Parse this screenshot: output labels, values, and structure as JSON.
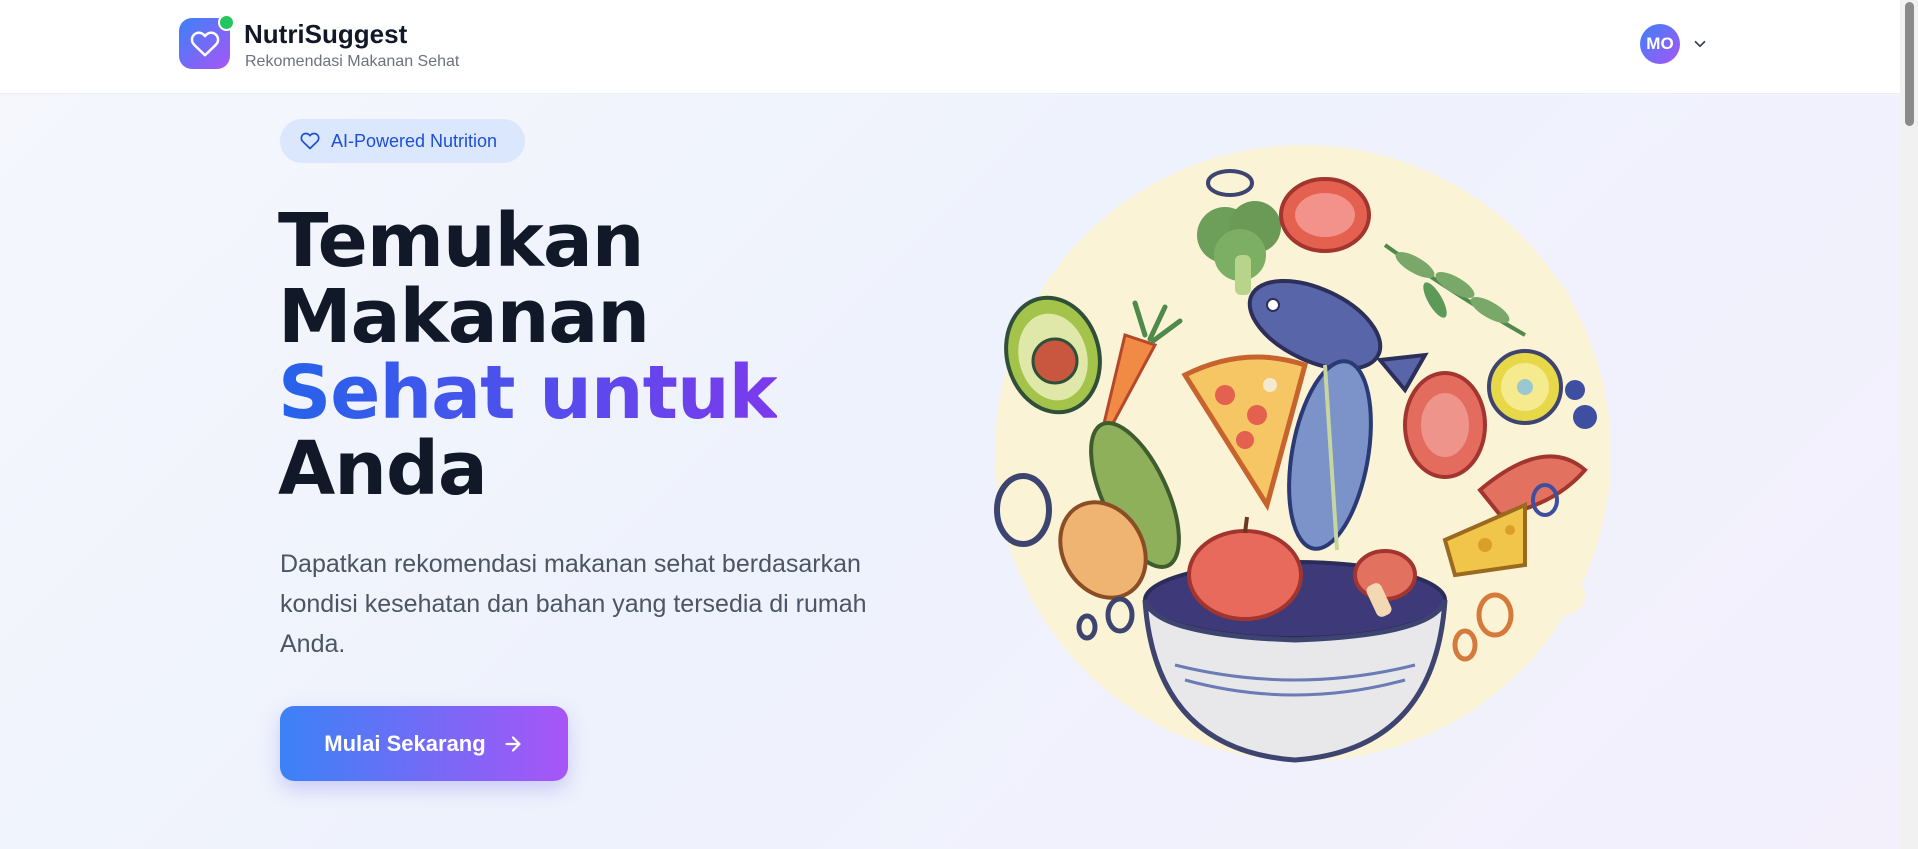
{
  "header": {
    "brand_name": "NutriSuggest",
    "brand_tagline": "Rekomendasi Makanan Sehat",
    "logo_icon": "heart-icon",
    "online_indicator_color": "#22c55e",
    "user_initials": "MO",
    "user_menu_icon": "chevron-down-icon"
  },
  "hero": {
    "badge_label": "AI-Powered Nutrition",
    "headline_line1": "Temukan",
    "headline_line2": "Makanan",
    "headline_highlight": "Sehat untuk",
    "headline_line4": "Anda",
    "description": "Dapatkan rekomendasi makanan sehat berdasarkan kondisi kesehatan dan bahan yang tersedia di rumah Anda.",
    "cta_label": "Mulai Sekarang",
    "cta_icon": "arrow-right-icon",
    "illustration": "healthy-food-bowl-illustration"
  },
  "colors": {
    "accent_start": "#3b82f6",
    "accent_end": "#a855f7",
    "heading": "#111827",
    "body_text": "#4b5563",
    "badge_bg": "#dbe7fd",
    "badge_text": "#1d4ed8"
  }
}
